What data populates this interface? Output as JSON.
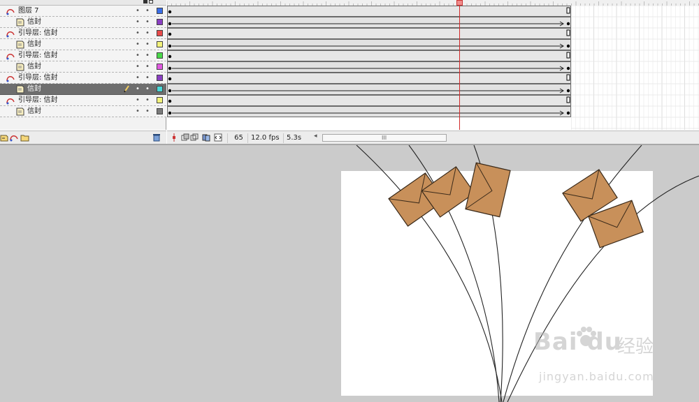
{
  "layers": [
    {
      "name": "图层 7",
      "type": "guide",
      "color": "#3a6ee8",
      "selected": false
    },
    {
      "name": "信封",
      "type": "guided",
      "color": "#8a3fc2",
      "selected": false
    },
    {
      "name": "引导层: 信封",
      "type": "guide",
      "color": "#e84a4a",
      "selected": false
    },
    {
      "name": "信封",
      "type": "guided",
      "color": "#f2f27a",
      "selected": false
    },
    {
      "name": "引导层: 信封",
      "type": "guide",
      "color": "#4ad84a",
      "selected": false
    },
    {
      "name": "信封",
      "type": "guided",
      "color": "#e05ae0",
      "selected": false
    },
    {
      "name": "引导层: 信封",
      "type": "guide",
      "color": "#8a3fc2",
      "selected": false
    },
    {
      "name": "信封",
      "type": "guided",
      "color": "#4ad8d8",
      "selected": true
    },
    {
      "name": "引导层: 信封",
      "type": "guide",
      "color": "#f2f27a",
      "selected": false
    },
    {
      "name": "信封",
      "type": "guided",
      "color": "#7a7a7a",
      "selected": false
    }
  ],
  "status": {
    "current_frame": "65",
    "frame_rate": "12.0 fps",
    "elapsed_time": "5.3s",
    "scroll_grip": "III",
    "scroll_arrow": "◂"
  },
  "watermark": {
    "brand": "Bai du",
    "brand_cn": "经验",
    "url": "jingyan.baidu.com"
  },
  "colors": {
    "envelope_fill": "#c8905a",
    "envelope_stroke": "#3a2a1a",
    "playhead": "#d12a2a",
    "stage": "#ffffff",
    "workspace": "#cbcbcb"
  }
}
